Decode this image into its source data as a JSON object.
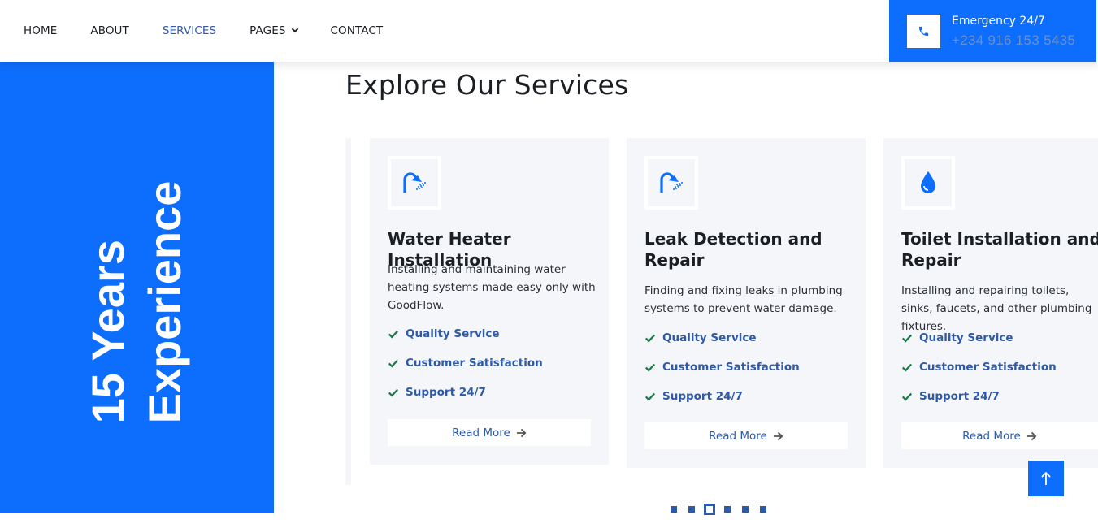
{
  "nav": {
    "items": [
      {
        "label": "HOME"
      },
      {
        "label": "ABOUT"
      },
      {
        "label": "SERVICES"
      },
      {
        "label": "PAGES"
      },
      {
        "label": "CONTACT"
      }
    ],
    "active": "SERVICES"
  },
  "emergency": {
    "label": "Emergency 24/7",
    "number": "+234 916 153 5435",
    "icon": "phone-icon"
  },
  "experience": {
    "line1": "15 Years",
    "line2": "Experience"
  },
  "section": {
    "title": "Explore Our Services"
  },
  "services": [
    {
      "icon": "shower-icon",
      "title": "Water Heater Installation",
      "description": "Installing and maintaining water heating systems made easy only with GoodFlow.",
      "features": [
        "Quality Service",
        "Customer Satisfaction",
        "Support 24/7"
      ],
      "button": "Read More"
    },
    {
      "icon": "shower-icon",
      "title": "Leak Detection and Repair",
      "description": "Finding and fixing leaks in plumbing systems to prevent water damage.",
      "features": [
        "Quality Service",
        "Customer Satisfaction",
        "Support 24/7"
      ],
      "button": "Read More"
    },
    {
      "icon": "water-drop-icon",
      "title": "Toilet Installation and Repair",
      "description": "Installing and repairing toilets, sinks, faucets, and other plumbing fixtures.",
      "features": [
        "Quality Service",
        "Customer Satisfaction",
        "Support 24/7"
      ],
      "button": "Read More"
    }
  ],
  "carousel": {
    "dot_count": 6,
    "active_dot": 3
  },
  "colors": {
    "primary": "#0d6efd",
    "link": "#2f5aa8",
    "check": "#1f7a4d",
    "card_bg": "#f4f6f9"
  }
}
